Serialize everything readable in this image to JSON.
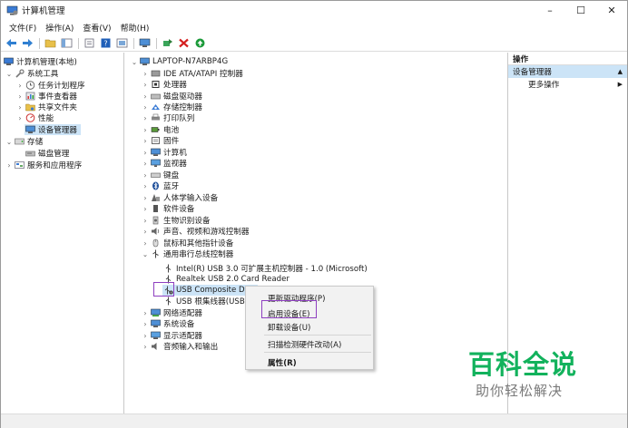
{
  "window": {
    "title": "计算机管理",
    "minimize": "–",
    "maximize": "☐",
    "close": "✕"
  },
  "menu": [
    "文件(F)",
    "操作(A)",
    "查看(V)",
    "帮助(H)"
  ],
  "left_tree": {
    "root": "计算机管理(本地)",
    "system_tools": "系统工具",
    "task_scheduler": "任务计划程序",
    "event_viewer": "事件查看器",
    "shared_folders": "共享文件夹",
    "performance": "性能",
    "device_manager": "设备管理器",
    "storage": "存储",
    "disk_management": "磁盘管理",
    "services_apps": "服务和应用程序"
  },
  "devices": {
    "computer": "LAPTOP-N7ARBP4G",
    "categories": [
      "IDE ATA/ATAPI 控制器",
      "处理器",
      "磁盘驱动器",
      "存储控制器",
      "打印队列",
      "电池",
      "固件",
      "计算机",
      "监视器",
      "键盘",
      "蓝牙",
      "人体学输入设备",
      "软件设备",
      "生物识别设备",
      "声音、视频和游戏控制器",
      "鼠标和其他指针设备",
      "通用串行总线控制器"
    ],
    "usb_children": [
      "Intel(R) USB 3.0 可扩展主机控制器 - 1.0 (Microsoft)",
      "Realtek USB 2.0 Card Reader",
      "USB Composite Dev",
      "USB 根集线器(USB 3"
    ],
    "after": [
      "网络适配器",
      "系统设备",
      "显示适配器",
      "音频输入和输出"
    ]
  },
  "context_menu": {
    "update_driver": "更新驱动程序(P)",
    "enable_device": "启用设备(E)",
    "uninstall_device": "卸载设备(U)",
    "scan_hardware": "扫描检测硬件改动(A)",
    "properties": "属性(R)"
  },
  "actions_pane": {
    "header": "操作",
    "section": "设备管理器",
    "more": "更多操作"
  },
  "watermark": {
    "big": "百科全说",
    "small": "助你轻松解决"
  },
  "colors": {
    "selection": "#cce4f7",
    "highlight_box": "#8e3fc0",
    "watermark_green": "#12b25c"
  }
}
